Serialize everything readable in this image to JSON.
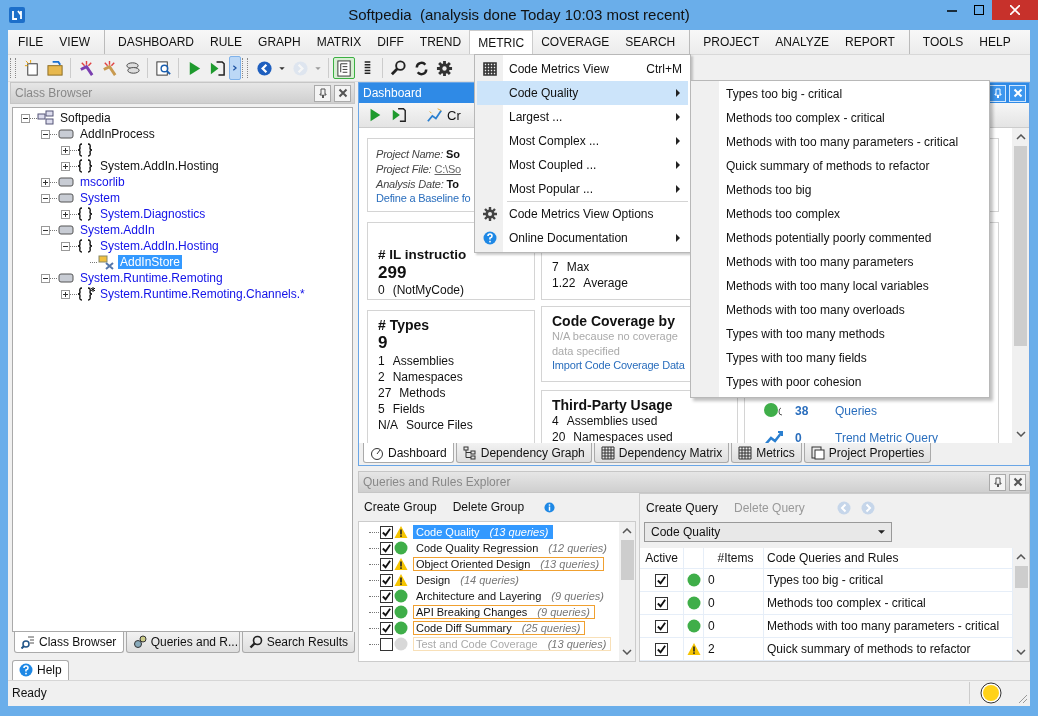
{
  "window": {
    "title": "Softpedia  (analysis done Today 10:03 most recent)"
  },
  "menu_bar": [
    {
      "label": "FILE",
      "open": false,
      "separator_before": false
    },
    {
      "label": "VIEW",
      "open": false,
      "separator_before": false
    },
    {
      "label": "DASHBOARD",
      "open": false,
      "separator_before": true
    },
    {
      "label": "RULE",
      "open": false,
      "separator_before": false
    },
    {
      "label": "GRAPH",
      "open": false,
      "separator_before": false
    },
    {
      "label": "MATRIX",
      "open": false,
      "separator_before": false
    },
    {
      "label": "DIFF",
      "open": false,
      "separator_before": false
    },
    {
      "label": "TREND",
      "open": false,
      "separator_before": false
    },
    {
      "label": "METRIC",
      "open": true,
      "separator_before": false
    },
    {
      "label": "COVERAGE",
      "open": false,
      "separator_before": false
    },
    {
      "label": "SEARCH",
      "open": false,
      "separator_before": false
    },
    {
      "label": "PROJECT",
      "open": false,
      "separator_before": true
    },
    {
      "label": "ANALYZE",
      "open": false,
      "separator_before": false
    },
    {
      "label": "REPORT",
      "open": false,
      "separator_before": false
    },
    {
      "label": "TOOLS",
      "open": false,
      "separator_before": true
    },
    {
      "label": "HELP",
      "open": false,
      "separator_before": false
    }
  ],
  "toolbar": [
    {
      "groups": [
        {
          "buttons": [
            {
              "kind": "new-project",
              "pressed": false,
              "disabled": false
            },
            {
              "kind": "open-project",
              "pressed": false,
              "disabled": false
            }
          ]
        },
        {
          "buttons": [
            {
              "kind": "analyze-vs",
              "pressed": false,
              "disabled": false
            },
            {
              "kind": "analyze",
              "pressed": false,
              "disabled": false
            },
            {
              "kind": "compare",
              "pressed": false,
              "disabled": false
            }
          ]
        },
        {
          "buttons": [
            {
              "kind": "search-doc",
              "pressed": false,
              "disabled": false
            }
          ]
        },
        {
          "buttons": [
            {
              "kind": "run",
              "pressed": false,
              "disabled": false
            },
            {
              "kind": "run-step",
              "pressed": false,
              "disabled": false
            },
            {
              "kind": "overflow",
              "pressed": true,
              "disabled": false
            }
          ]
        }
      ]
    },
    {
      "groups": [
        {
          "buttons": [
            {
              "kind": "back",
              "pressed": false,
              "disabled": false
            },
            {
              "kind": "dropdown",
              "pressed": false,
              "disabled": false
            },
            {
              "kind": "forward",
              "pressed": false,
              "disabled": true
            },
            {
              "kind": "dropdown",
              "pressed": false,
              "disabled": true
            }
          ]
        },
        {
          "buttons": [
            {
              "kind": "tree",
              "pressed": true,
              "disabled": false
            },
            {
              "kind": "list",
              "pressed": false,
              "disabled": false
            }
          ]
        },
        {
          "buttons": [
            {
              "kind": "search",
              "pressed": false,
              "disabled": false
            },
            {
              "kind": "refresh",
              "pressed": false,
              "disabled": false
            },
            {
              "kind": "settings",
              "pressed": false,
              "disabled": false
            }
          ]
        }
      ]
    }
  ],
  "class_browser": {
    "title": "Class Browser",
    "tree": [
      {
        "label": "Softpedia",
        "kind": "solution",
        "expanded": true,
        "external": false,
        "selected": false,
        "children": [
          {
            "label": "AddInProcess",
            "kind": "assembly",
            "expanded": true,
            "external": false,
            "selected": false,
            "children": [
              {
                "kind": "namespace",
                "expanded": false
              },
              {
                "label": "System.AddIn.Hosting",
                "kind": "namespace",
                "expanded": false,
                "external": false,
                "selected": false
              }
            ]
          },
          {
            "label": "mscorlib",
            "kind": "assembly",
            "expanded": false,
            "external": true,
            "selected": false
          },
          {
            "label": "System",
            "kind": "assembly",
            "expanded": true,
            "external": true,
            "selected": false,
            "children": [
              {
                "label": "System.Diagnostics",
                "kind": "namespace",
                "expanded": false,
                "external": true,
                "selected": false
              }
            ]
          },
          {
            "label": "System.AddIn",
            "kind": "assembly",
            "expanded": true,
            "external": true,
            "selected": false,
            "children": [
              {
                "label": "System.AddIn.Hosting",
                "kind": "namespace",
                "expanded": true,
                "external": true,
                "selected": false,
                "children": [
                  {
                    "label": "AddInStore",
                    "kind": "type",
                    "external": true,
                    "selected": true
                  }
                ]
              }
            ]
          },
          {
            "label": "System.Runtime.Remoting",
            "kind": "assembly",
            "expanded": true,
            "external": true,
            "selected": false,
            "children": [
              {
                "label": "System.Runtime.Remoting.Channels.*",
                "kind": "namespace-group",
                "expanded": false,
                "external": true,
                "selected": false
              }
            ]
          }
        ]
      }
    ],
    "tabs": [
      {
        "label": "Class Browser",
        "kind": "class-browser",
        "selected": true
      },
      {
        "label": "Queries and R...",
        "kind": "queries",
        "selected": false
      },
      {
        "label": "Search Results",
        "kind": "search",
        "selected": false
      }
    ]
  },
  "dashboard": {
    "title": "Dashboard",
    "toolbar_label": "Cr",
    "project": {
      "lines": [
        {
          "label": "Project Name:",
          "value": "So",
          "kind": "bold"
        },
        {
          "label": "Project File:",
          "value": "C:\\So",
          "kind": "link"
        },
        {
          "label": "Analysis Date:",
          "value": "To",
          "kind": "bold"
        }
      ],
      "baseline_link": "Define a Baseline fo"
    },
    "il_card": {
      "title": "# IL instructio",
      "value": "299",
      "rows": [
        {
          "count": "0",
          "label": "(NotMyCode)"
        }
      ]
    },
    "types_card": {
      "title": "# Types",
      "value": "9",
      "rows": [
        {
          "count": "1",
          "label": "Assemblies"
        },
        {
          "count": "2",
          "label": "Namespaces"
        },
        {
          "count": "27",
          "label": "Methods"
        },
        {
          "count": "5",
          "label": "Fields"
        },
        {
          "count": "N/A",
          "label": "Source Files"
        }
      ]
    },
    "complexity_card": {
      "rows": [
        {
          "count": "7",
          "label": "Max"
        },
        {
          "count": "1.22",
          "label": "Average"
        }
      ]
    },
    "coverage_card": {
      "title": "Code Coverage by",
      "note": "N/A because no coverage data specified",
      "link": "Import Code Coverage Data"
    },
    "third_party_card": {
      "title": "Third-Party Usage",
      "rows": [
        {
          "count": "4",
          "label": "Assemblies used"
        },
        {
          "count": "20",
          "label": "Namespaces used"
        }
      ]
    },
    "rules_card": {
      "rows": [
        {
          "kind": "rules",
          "count": "38",
          "label": "Queries"
        },
        {
          "kind": "trend",
          "count": "0",
          "label": "Trend Metric Query"
        }
      ]
    },
    "tabs": [
      {
        "label": "Dashboard",
        "kind": "dashboard",
        "selected": true
      },
      {
        "label": "Dependency Graph",
        "kind": "graph",
        "selected": false
      },
      {
        "label": "Dependency Matrix",
        "kind": "matrix",
        "selected": false
      },
      {
        "label": "Metrics",
        "kind": "metrics",
        "selected": false
      },
      {
        "label": "Project Properties",
        "kind": "properties",
        "selected": false
      }
    ]
  },
  "explorer": {
    "title": "Queries and Rules Explorer",
    "group_actions": [
      {
        "label": "Create Group",
        "disabled": false
      },
      {
        "label": "Delete Group",
        "disabled": false
      }
    ],
    "groups": [
      {
        "label": "Code Quality",
        "count": "(13 queries)",
        "checked": true,
        "kind": "warning",
        "selected": true,
        "outlined": false
      },
      {
        "label": "Code Quality Regression",
        "count": "(12 queries)",
        "checked": true,
        "kind": "ok",
        "selected": false,
        "outlined": false
      },
      {
        "label": "Object Oriented Design",
        "count": "(13 queries)",
        "checked": true,
        "kind": "warning",
        "selected": false,
        "outlined": true
      },
      {
        "label": "Design",
        "count": "(14 queries)",
        "checked": true,
        "kind": "warning",
        "selected": false,
        "outlined": false
      },
      {
        "label": "Architecture and Layering",
        "count": "(9 queries)",
        "checked": true,
        "kind": "ok",
        "selected": false,
        "outlined": false
      },
      {
        "label": "API Breaking Changes",
        "count": "(9 queries)",
        "checked": true,
        "kind": "ok",
        "selected": false,
        "outlined": true
      },
      {
        "label": "Code Diff Summary",
        "count": "(25 queries)",
        "checked": true,
        "kind": "ok",
        "selected": false,
        "outlined": true
      },
      {
        "label": "Test and Code Coverage",
        "count": "(13 queries)",
        "checked": false,
        "kind": "inactive",
        "selected": false,
        "outlined": true
      }
    ],
    "query_actions": [
      {
        "label": "Create Query",
        "disabled": false
      },
      {
        "label": "Delete Query",
        "disabled": true
      }
    ],
    "nav": [
      {
        "kind": "back",
        "disabled": true
      },
      {
        "kind": "forward",
        "disabled": true
      }
    ],
    "group_select": {
      "value": "Code Quality"
    },
    "columns": {
      "active": "Active",
      "items": "#Items",
      "name": "Code Queries and Rules"
    },
    "queries": [
      {
        "active": true,
        "kind": "ok",
        "items": "0",
        "name": "Types too big - critical"
      },
      {
        "active": true,
        "kind": "ok",
        "items": "0",
        "name": "Methods too complex - critical"
      },
      {
        "active": true,
        "kind": "ok",
        "items": "0",
        "name": "Methods with too many parameters - critical"
      },
      {
        "active": true,
        "kind": "warning",
        "items": "2",
        "name": "Quick summary of methods to refactor"
      }
    ]
  },
  "help_tab": {
    "label": "Help",
    "selected": true
  },
  "status_bar": {
    "text": "Ready",
    "kind": "warning"
  },
  "metric_menu": {
    "items": [
      {
        "kind": "view",
        "label": "Code Metrics View",
        "shortcut": "Ctrl+M",
        "submenu": false,
        "selected": false
      },
      {
        "kind": "item",
        "label": "Code Quality",
        "submenu": true,
        "selected": true
      },
      {
        "kind": "item",
        "label": "Largest ...",
        "submenu": true,
        "selected": false
      },
      {
        "kind": "item",
        "label": "Most Complex ...",
        "submenu": true,
        "selected": false
      },
      {
        "kind": "item",
        "label": "Most Coupled ...",
        "submenu": true,
        "selected": false
      },
      {
        "kind": "item",
        "label": "Most Popular ...",
        "submenu": true,
        "selected": false
      },
      {
        "kind": "separator"
      },
      {
        "kind": "options",
        "label": "Code Metrics View Options",
        "submenu": false,
        "selected": false
      },
      {
        "kind": "help",
        "label": "Online Documentation",
        "submenu": true,
        "selected": false
      }
    ]
  },
  "code_quality_submenu": [
    "Types too big - critical",
    "Methods too complex - critical",
    "Methods with too many parameters - critical",
    "Quick summary of methods to refactor",
    "Methods too big",
    "Methods too complex",
    "Methods potentially poorly commented",
    "Methods with too many parameters",
    "Methods with too many local variables",
    "Methods with too many overloads",
    "Types with too many methods",
    "Types with too many fields",
    "Types with poor cohesion"
  ]
}
